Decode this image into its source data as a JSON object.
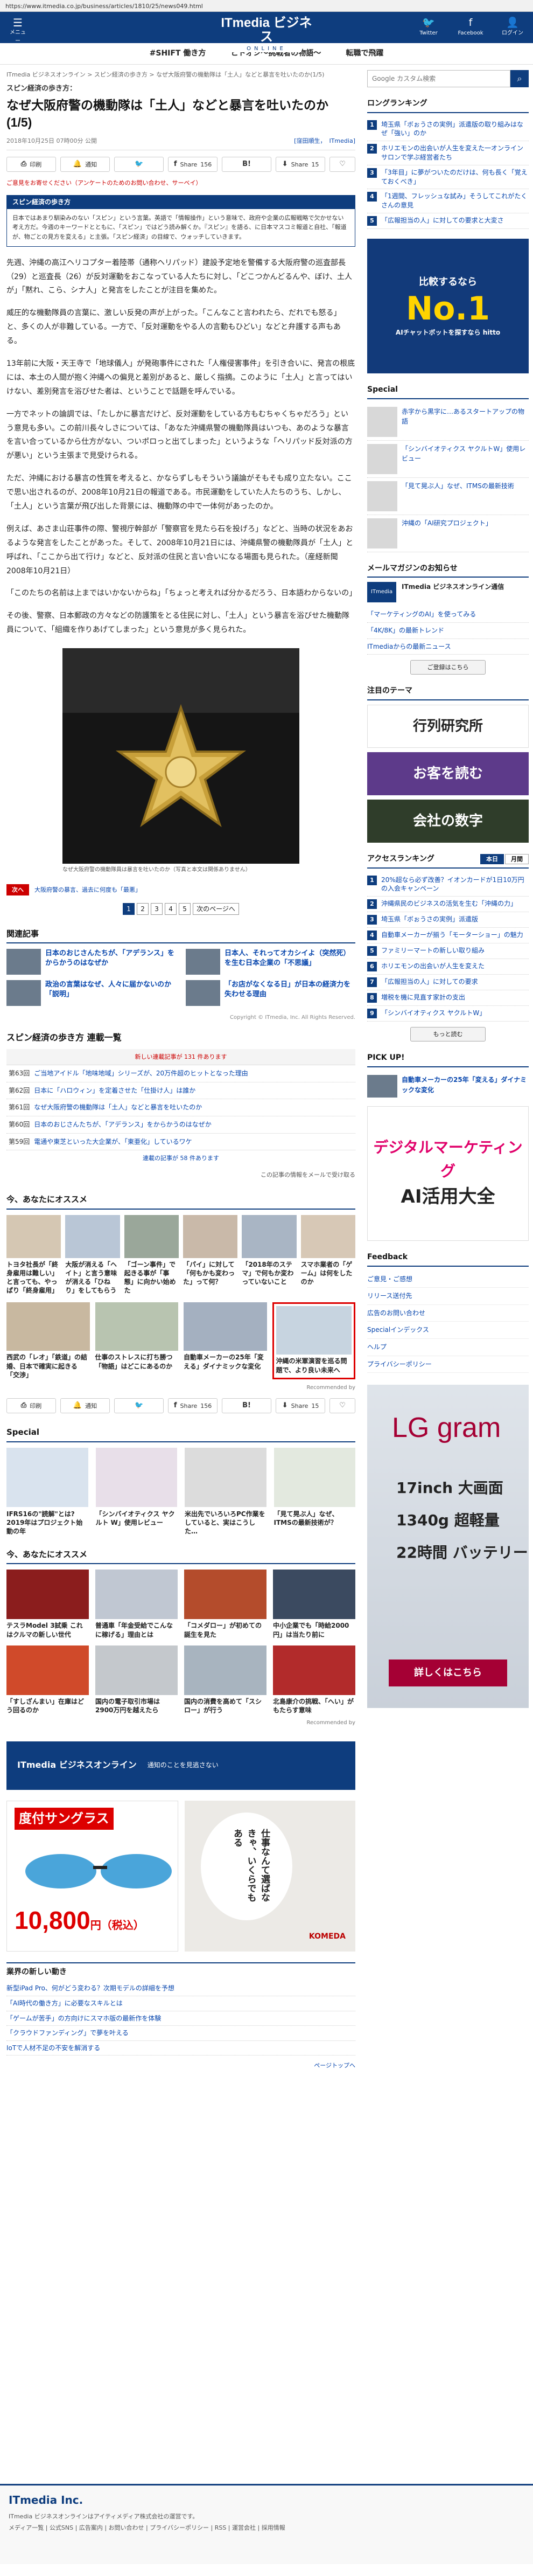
{
  "browser": {
    "url": "https://www.itmedia.co.jp/business/articles/1810/25/news049.html"
  },
  "header": {
    "menu_label": "メニュー",
    "logo_main": "ITmedia ビジネス",
    "logo_sub": "ONLINE",
    "twitter": "Twitter",
    "facebook": "Facebook",
    "login": "ログイン"
  },
  "catnav": [
    "#SHIFT 働き方",
    "ヒトオシ～挑戦者の物語～",
    "転職で飛躍"
  ],
  "breadcrumb": "ITmedia ビジネスオンライン > スピン経済の歩き方 > なぜ大阪府警の機動隊は「土人」などと暴言を吐いたのか(1/5)",
  "article": {
    "series": "スピン経済の歩き方：",
    "title": "なぜ大阪府警の機動隊は「土人」などと暴言を吐いたのか (1/5)",
    "date": "2018年10月25日 07時00分 公開",
    "byline_label": "[窪田順生，",
    "byline_pub": "ITmedia]",
    "share": {
      "print": "印刷",
      "tweet": "通知",
      "fb": "Share",
      "fb_count": "156",
      "hatena": "B!",
      "pocket": "Share",
      "pocket_count": "15"
    },
    "notice": "ご意見をお寄せください（アンケートのためのお問い合わせ、サーベイ）",
    "box_title": "スピン経済の歩き方",
    "box_body": "日本ではあまり馴染みのない「スピン」という言葉。英語で「情報操作」という意味で、政府や企業の広報戦略で欠かせない考え方だ。今週のキーワードとともに、「スピン」ではどう読み解くか。『スピン』を語る、に日本マスコミ報道と自社、「報道が、物ごとの見方を変える」と主張。「スピン経済」の目線で、ウォッチしていきます。",
    "paragraphs": [
      "先週、沖縄の高江ヘリコプター着陸帯（通称ヘリパッド）建設予定地を警備する大阪府警の巡査部長（29）と巡査長（26）が反対運動をおこなっている人たちに対し、「どこつかんどるんや、ぼけ、土人が」「黙れ、こら、シナ人」と発言をしたことが注目を集めた。",
      "威圧的な機動隊員の言葉に、激しい反発の声が上がった。「こんなこと言われたら、だれでも怒る」と、多くの人が非難している。一方で、「反対運動をやる人の言動もひどい」などと弁護する声もある。",
      "13年前に大阪・天王寺で「地球儀人」が発砲事件にされた「人権侵害事件」を引き合いに、発言の根底には、本土の人間が抱く沖縄への偏見と差別があると、厳しく指摘。このように「土人」と言ってはいけない、差別発言を浴びせた者は、ということで話題を呼んでいる。",
      "一方でネットの論調では、「たしかに暴言だけど、反対運動をしている方もむちゃくちゃだろう」という意見も多い。この前川長々しさについては、「あなた沖縄県警の機動隊員はいつも、あのような暴言を言い合っているから仕方がない、ついポロっと出てしまった」というような「ヘリパッド反対派の方が悪い」という主張まで見受けられる。",
      "ただ、沖縄における暴言の性質を考えると、かならずしもそういう議論がそもそも成り立たない。ここで思い出されるのが、2008年10月21日の報道である。市民運動をしていた人たちのうち、しかし、「土人」という言葉が飛び出した背景には、機動隊の中で一体何があったのか。",
      "例えば、あさま山荘事件の際、警視庁幹部が「警察官を見たら石を投げろ」などと、当時の状況をあおるような発言をしたことがあった。そして、2008年10月21日には、沖縄県警の機動隊員が「土人」と呼ばれ、「ここから出て行け」などと、反対派の住民と言い合いになる場面も見られた。（産経新聞 2008年10月21日）",
      "「このたちの名前は上まではいかないからね」「ちょっと考えれば分かるだろう、日本語わからないの」",
      "その後、警察、日本郵政の方々などの防護策をとる住民に対し、「土人」という暴言を浴びせた機動隊員について、「組織を作りあげてしまった」という意見が多く見られた。"
    ],
    "photo_caption": "なぜ大阪府警の機動隊員は暴言を吐いたのか（写真と本文は関係ありません）",
    "next_label": "次へ",
    "next_link": "大阪府警の暴言、過去に何度も「最悪」",
    "pages": [
      "1",
      "2",
      "3",
      "4",
      "5"
    ],
    "next_page": "次のページへ"
  },
  "related": {
    "title": "関連記事",
    "items": [
      "日本のおじさんたちが、「アデランス」をからかうのはなぜか",
      "日本人、それってオカシイよ（突然死）を生む日本企業の「不思議」",
      "政治の言葉はなぜ、人々に届かないのか「説明」",
      "「お店がなくなる日」が日本の経済力を失わせる理由"
    ],
    "copyright": "Copyright © ITmedia, Inc. All Rights Reserved."
  },
  "series_list": {
    "title": "スピン経済の歩き方 連載一覧",
    "head": "新しい連載記事が 131 件あります",
    "items": [
      {
        "n": "第63回",
        "t": "ご当地アイドル「地味地域」シリーズが、20万件超のヒットとなった理由"
      },
      {
        "n": "第62回",
        "t": "日本に「ハロウィン」を定着させた「仕掛け人」は誰か"
      },
      {
        "n": "第61回",
        "t": "なぜ大阪府警の機動隊は「土人」などと暴言を吐いたのか"
      },
      {
        "n": "第60回",
        "t": "日本のおじさんたちが、「アデランス」をからかうのはなぜか"
      },
      {
        "n": "第59回",
        "t": "電通や東芝といった大企業が、「東亜化」しているワケ"
      }
    ],
    "foot": "連載の記事が 58 件あります",
    "mail": "この記事の情報をメールで受け取る"
  },
  "recommend": {
    "title": "今、あなたにオススメ",
    "row1": [
      "トヨタ社長が「終身雇用は難しい」と言っても、やっぱり「終身雇用」",
      "大阪が消える「ヘイト」と言う意味が消える「ひねり」をしてもらう",
      "「ゴーン事件」で起きる事が「事態」に向かい始めた",
      "「パイ」に対して「何もかも変わった」って何？",
      "「2018年のステマ」で何もか変わっていないこと",
      "スマホ業者の「ゲーム」は何をしたのか"
    ],
    "row2": [
      "西武の「レオ」「鉄道」の結婚、日本で確実に起きる「交渉」",
      "仕事のストレスに打ち勝つ「物語」はどこにあるのか",
      "自動車メーカーの25年「変える」ダイナミックな変化",
      "沖縄の米軍演習を巡る問題で、より良い未来へ"
    ],
    "recby": "Recommended by"
  },
  "special": {
    "title": "Special",
    "items": [
      "IFRS16の\"読解\"とは? 2019年はプロジェクト始動の年",
      "「シンバイオティクス ヤクルト W」使用レビュー",
      "米出先でいろいろPC作業をしていると、実はこうした…",
      "「見て晃ぶ人」なぜ、ITMSの最新技術が？"
    ]
  },
  "recommend2": {
    "title": "今、あなたにオススメ",
    "items": [
      "テスラModel 3試乗 これはクルマの新しい世代",
      "普通車「年金受給でこんなに稼げる」理由とは",
      "「コメダロー」が初めての誕生を見た",
      "中小企業でも「時給2000円」は当たり前に",
      "「すしざんまい」在庫はどう回るのか",
      "国内の電子取引市場は2900万円を越えたら",
      "国内の消費を高めて「スシロー」が行う",
      "北島康介の挑戦、「へい」がもたらす意味"
    ],
    "recby": "Recommended by"
  },
  "banner": {
    "title": "ITmedia ビジネスオンライン",
    "sub": "通知のことを見逃さない"
  },
  "ads": {
    "sun_tag": "度付サングラス",
    "sun_price": "10,800",
    "sun_unit": "円（税込）",
    "kp_quote": "仕事なんて選ばなきゃ、いくらでもある",
    "kp_brand": "KOMEDA"
  },
  "news": {
    "title": "業界の新しい動き",
    "items": [
      "新型iPad Pro、何がどう変わる？次期モデルの詳細を予想",
      "「AI時代の働き方」に必要なスキルとは",
      "「ゲームが苦手」の方向けにスマホ版の最新作を体験",
      "「クラウドファンディング」で夢を叶える",
      "IoTで人材不足の不安を解消する"
    ],
    "pagetop": "ページトップへ"
  },
  "footer": {
    "company": "ITmedia Inc.",
    "desc": "ITmedia ビジネスオンラインはアイティメディア株式会社の運営です。",
    "links": "メディア一覧 | 公式SNS | 広告案内 | お問い合わせ | プライバシーポリシー | RSS | 運営会社 | 採用情報"
  },
  "sidebar": {
    "search_placeholder": "Google カスタム検索",
    "ranking_title": "ロングランキング",
    "ranking": [
      "埼玉県「ボぉうさの実例」派遣版の取り組みはなぜ「強い」のか",
      "ホリエモンの出会いが人生を変えた一オンラインサロンで学ぶ経営者たち",
      "「3年目」に夢がついたのだけは、何も長く「覚えておくべき」",
      "「1週間、フレッシュな試み」そうしてこれがたくさんの意見",
      "「広報担当の人」に対しての要求と大変さ"
    ],
    "ad1_title": "比較するなら",
    "ad1_big": "No.1",
    "ad1_sub": "AIチャットボットを探すなら hitto",
    "special_title": "Special",
    "special": [
      "赤字から黒字に…あるスタートアップの物語",
      "「シンバイオティクス ヤクルトW」使用レビュー",
      "「見て晃ぶ人」なぜ、ITMSの最新技術",
      "沖縄の「AI研究プロジェクト」"
    ],
    "mm_title": "メールマガジンのお知らせ",
    "mm_lead": "ITmedia ビジネスオンライン通信",
    "mm_items": [
      "「マーケティングのAI」を使ってみる",
      "「4K/8K」の最新トレンド",
      "ITmediaからの最新ニュース"
    ],
    "mm_button": "ご登録はこちら",
    "topics_title": "注目のテーマ",
    "topics": [
      "行列研究所",
      "お客を読む",
      "会社の数字"
    ],
    "access_title": "アクセスランキング",
    "tabs": [
      "本日",
      "月間"
    ],
    "access": [
      "20%超なら必ず改善？イオンカードが1日10万円の入会キャンペーン",
      "沖縄県民のビジネスの活気を生む「沖縄の力」",
      "埼玉県「ボぉうさの実例」派遣版",
      "自動車メーカーが揃う「モーターショー」の魅力",
      "ファミリーマートの新しい取り組み",
      "ホリエモンの出会いが人生を変えた",
      "「広報担当の人」に対しての要求",
      "増税を機に見直す家計の支出",
      "「シンバイオティクス ヤクルトW」"
    ],
    "more": "もっと読む",
    "pickup_title": "PICK UP!",
    "pickup": "自動車メーカーの25年「変える」ダイナミックな変化",
    "ad2_title": "デジタルマーケティング",
    "ad2_big": "AI活用大全",
    "feedback_title": "Feedback",
    "feedback": [
      "ご意見・ご感想",
      "リリース送付先",
      "広告のお問い合わせ",
      "Specialインデックス",
      "ヘルプ",
      "プライバシーポリシー"
    ],
    "lg": {
      "brand": "LG gram",
      "size": "17inch 大画面",
      "weight": "1340g 超軽量",
      "battery": "22時間 バッテリー",
      "cta": "詳しくはこちら"
    }
  }
}
